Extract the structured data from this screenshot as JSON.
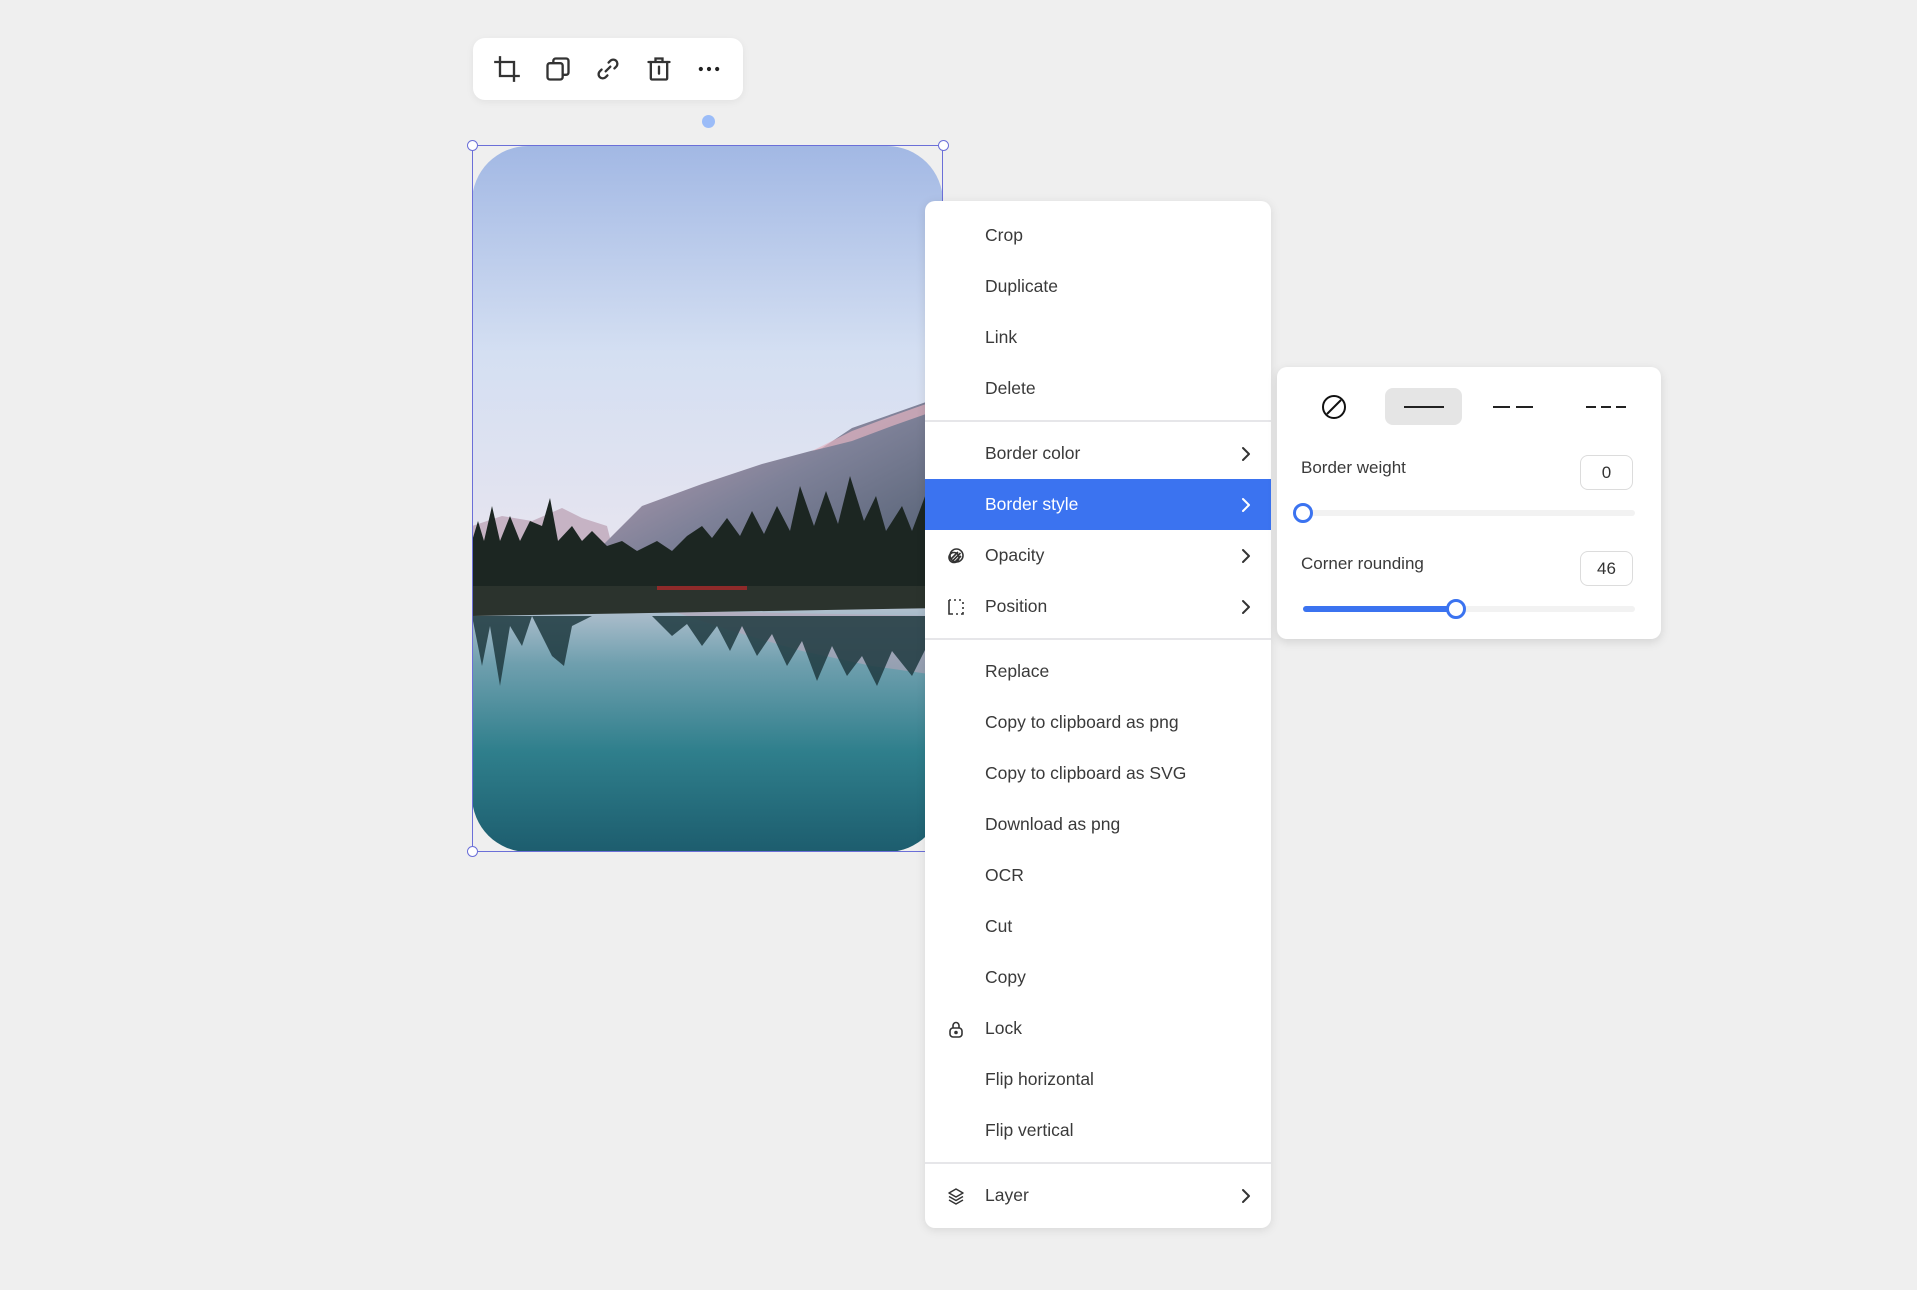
{
  "toolbar": {
    "buttons": [
      {
        "name": "crop",
        "icon": "crop-icon"
      },
      {
        "name": "duplicate",
        "icon": "duplicate-icon"
      },
      {
        "name": "link",
        "icon": "link-icon"
      },
      {
        "name": "delete",
        "icon": "trash-icon"
      },
      {
        "name": "more",
        "icon": "more-horizontal-icon"
      }
    ]
  },
  "canvas": {
    "selected_object": "image",
    "image_description": "mountain lake at dusk with pine trees and reflection",
    "corner_rounding": 46
  },
  "context_menu": {
    "groups": [
      [
        {
          "label": "Crop",
          "icon": null,
          "submenu": false
        },
        {
          "label": "Duplicate",
          "icon": null,
          "submenu": false
        },
        {
          "label": "Link",
          "icon": null,
          "submenu": false
        },
        {
          "label": "Delete",
          "icon": null,
          "submenu": false
        }
      ],
      [
        {
          "label": "Border color",
          "icon": null,
          "submenu": true
        },
        {
          "label": "Border style",
          "icon": null,
          "submenu": true,
          "active": true
        },
        {
          "label": "Opacity",
          "icon": "opacity-icon",
          "submenu": true
        },
        {
          "label": "Position",
          "icon": "position-icon",
          "submenu": true
        }
      ],
      [
        {
          "label": "Replace",
          "icon": null,
          "submenu": false
        },
        {
          "label": "Copy to clipboard as png",
          "icon": null,
          "submenu": false
        },
        {
          "label": "Copy to clipboard as SVG",
          "icon": null,
          "submenu": false
        },
        {
          "label": "Download as png",
          "icon": null,
          "submenu": false
        },
        {
          "label": "OCR",
          "icon": null,
          "submenu": false
        },
        {
          "label": "Cut",
          "icon": null,
          "submenu": false
        },
        {
          "label": "Copy",
          "icon": null,
          "submenu": false
        },
        {
          "label": "Lock",
          "icon": "lock-icon",
          "submenu": false
        },
        {
          "label": "Flip horizontal",
          "icon": null,
          "submenu": false
        },
        {
          "label": "Flip vertical",
          "icon": null,
          "submenu": false
        }
      ],
      [
        {
          "label": "Layer",
          "icon": "layers-icon",
          "submenu": true
        }
      ]
    ],
    "active_color": "#3b73f0"
  },
  "border_style_panel": {
    "styles": [
      {
        "name": "none",
        "icon": "no-border-icon",
        "selected": false
      },
      {
        "name": "solid",
        "icon": "solid-line-icon",
        "selected": true
      },
      {
        "name": "dashed",
        "icon": "dashed-line-icon",
        "selected": false
      },
      {
        "name": "dotted",
        "icon": "dotted-line-icon",
        "selected": false
      }
    ],
    "border_weight": {
      "label": "Border weight",
      "value": "0",
      "fraction": 0.0
    },
    "corner_rounding": {
      "label": "Corner rounding",
      "value": "46",
      "fraction": 0.46
    }
  }
}
